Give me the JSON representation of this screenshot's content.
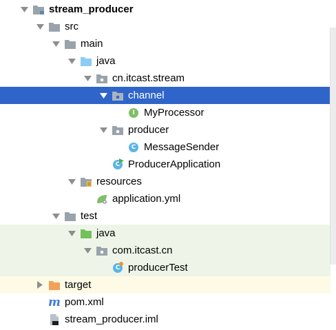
{
  "colors": {
    "selected_row": "#2f65ca",
    "test_rows": "#eef5e8",
    "excluded_row": "#fdfbe6",
    "folder": "#9aa3ab",
    "source_folder": "#8ccdf3",
    "test_folder": "#74c05c",
    "excluded_folder": "#f2a05c",
    "class_icon": "#5bb5e6",
    "interface_icon": "#7fbf67"
  },
  "tree": {
    "root": {
      "label": "stream_producer",
      "icon": "module-folder-icon"
    },
    "src": {
      "label": "src",
      "icon": "folder-icon"
    },
    "main": {
      "label": "main",
      "icon": "folder-icon"
    },
    "java": {
      "label": "java",
      "icon": "source-folder-icon"
    },
    "pkg": {
      "label": "cn.itcast.stream",
      "icon": "package-icon"
    },
    "channel": {
      "label": "channel",
      "icon": "package-icon"
    },
    "myprocessor": {
      "label": "MyProcessor",
      "icon": "interface-icon",
      "badge": "I"
    },
    "producer_pkg": {
      "label": "producer",
      "icon": "package-icon"
    },
    "messagesender": {
      "label": "MessageSender",
      "icon": "class-icon",
      "badge": "C"
    },
    "producerapp": {
      "label": "ProducerApplication",
      "icon": "spring-boot-class-icon",
      "badge": "C"
    },
    "resources": {
      "label": "resources",
      "icon": "resources-folder-icon"
    },
    "appyml": {
      "label": "application.yml",
      "icon": "spring-yml-icon"
    },
    "test": {
      "label": "test",
      "icon": "folder-icon"
    },
    "test_java": {
      "label": "java",
      "icon": "test-source-folder-icon"
    },
    "test_pkg": {
      "label": "com.itcast.cn",
      "icon": "package-icon"
    },
    "producertest": {
      "label": "producerTest",
      "icon": "class-icon",
      "badge": "C"
    },
    "target": {
      "label": "target",
      "icon": "excluded-folder-icon"
    },
    "pom": {
      "label": "pom.xml",
      "icon": "maven-icon",
      "badge": "m"
    },
    "iml": {
      "label": "stream_producer.iml",
      "icon": "iml-file-icon"
    }
  }
}
